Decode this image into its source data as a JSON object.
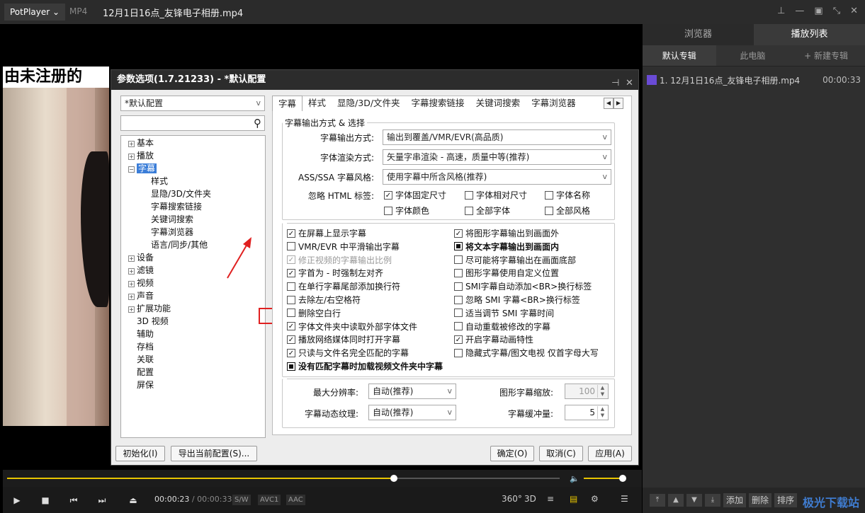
{
  "titlebar": {
    "app": "PotPlayer",
    "app_chevron": "⌄",
    "format": "MP4",
    "title": "12月1日16点_友锋电子相册.mp4",
    "buttons": [
      "pin-icon",
      "minimize-icon",
      "maximize-icon",
      "shrink-icon",
      "close-icon"
    ]
  },
  "video": {
    "overlay_text": "由未注册的"
  },
  "dialog": {
    "title": "参数选项(1.7.21233) - *默认配置",
    "profile_select": "*默认配置",
    "search_placeholder": "",
    "tree": [
      {
        "label": "基本",
        "expander": "+"
      },
      {
        "label": "播放",
        "expander": "+"
      },
      {
        "label": "字幕",
        "expander": "−",
        "selected": true
      },
      {
        "label": "样式"
      },
      {
        "label": "显隐/3D/文件夹"
      },
      {
        "label": "字幕搜索链接"
      },
      {
        "label": "关键词搜索"
      },
      {
        "label": "字幕浏览器"
      },
      {
        "label": "语言/同步/其他"
      },
      {
        "label": "设备",
        "expander": "+"
      },
      {
        "label": "滤镜",
        "expander": "+"
      },
      {
        "label": "视频",
        "expander": "+"
      },
      {
        "label": "声音",
        "expander": "+"
      },
      {
        "label": "扩展功能",
        "expander": "+"
      },
      {
        "label": "3D 视频"
      },
      {
        "label": "辅助"
      },
      {
        "label": "存档"
      },
      {
        "label": "关联"
      },
      {
        "label": "配置"
      },
      {
        "label": "屏保"
      }
    ],
    "tabs": [
      "字幕",
      "样式",
      "显隐/3D/文件夹",
      "字幕搜索链接",
      "关键词搜索",
      "字幕浏览器"
    ],
    "group_title": "字幕输出方式 & 选择",
    "output_mode_label": "字幕输出方式:",
    "output_mode_value": "输出到覆盖/VMR/EVR(高品质)",
    "font_render_label": "字体渲染方式:",
    "font_render_value": "矢量字串渲染 - 高速，质量中等(推荐)",
    "ass_label": "ASS/SSA 字幕风格:",
    "ass_value": "使用字幕中所含风格(推荐)",
    "html_label": "忽略 HTML 标签:",
    "html_opts": [
      {
        "label": "字体固定尺寸",
        "checked": true
      },
      {
        "label": "字体相对尺寸",
        "checked": false
      },
      {
        "label": "字体名称",
        "checked": false
      },
      {
        "label": "字体颜色",
        "checked": false
      },
      {
        "label": "全部字体",
        "checked": false
      },
      {
        "label": "全部风格",
        "checked": false
      }
    ],
    "left_checks": [
      {
        "label": "在屏幕上显示字幕",
        "state": "checked"
      },
      {
        "label": "VMR/EVR 中平滑输出字幕",
        "state": "unchecked"
      },
      {
        "label": "修正视频的字幕输出比例",
        "state": "disabled-checked"
      },
      {
        "label": "字首为 - 时强制左对齐",
        "state": "checked"
      },
      {
        "label": "在单行字幕尾部添加换行符",
        "state": "unchecked"
      },
      {
        "label": "去除左/右空格符",
        "state": "unchecked"
      },
      {
        "label": "删除空白行",
        "state": "unchecked"
      },
      {
        "label": "字体文件夹中读取外部字体文件",
        "state": "checked"
      },
      {
        "label": "播放网络媒体同时打开字幕",
        "state": "checked"
      },
      {
        "label": "只读与文件名完全匹配的字幕",
        "state": "checked"
      }
    ],
    "right_checks": [
      {
        "label": "将图形字幕输出到画面外",
        "state": "checked"
      },
      {
        "label": "将文本字幕输出到画面内",
        "state": "filled"
      },
      {
        "label": "尽可能将字幕输出在画面底部",
        "state": "unchecked"
      },
      {
        "label": "图形字幕使用自定义位置",
        "state": "unchecked"
      },
      {
        "label": "SMI字幕自动添加<BR>换行标签",
        "state": "unchecked"
      },
      {
        "label": "忽略 SMI 字幕<BR>换行标签",
        "state": "unchecked"
      },
      {
        "label": "适当调节 SMI 字幕时间",
        "state": "unchecked"
      },
      {
        "label": "自动重载被修改的字幕",
        "state": "unchecked"
      },
      {
        "label": "开启字幕动画特性",
        "state": "checked"
      },
      {
        "label": "隐藏式字幕/图文电视 仅首字母大写",
        "state": "unchecked"
      }
    ],
    "wide_check": {
      "label": "没有匹配字幕时加载视频文件夹中字幕",
      "state": "filled"
    },
    "max_res_label": "最大分辨率:",
    "max_res_value": "自动(推荐)",
    "anim_tex_label": "字幕动态纹理:",
    "anim_tex_value": "自动(推荐)",
    "gfx_scale_label": "图形字幕缩放:",
    "gfx_scale_value": "100",
    "buffer_label": "字幕缓冲量:",
    "buffer_value": "5",
    "buttons": {
      "init": "初始化(I)",
      "export": "导出当前配置(S)...",
      "ok": "确定(O)",
      "cancel": "取消(C)",
      "apply": "应用(A)"
    }
  },
  "side": {
    "tabs": [
      "浏览器",
      "播放列表"
    ],
    "active_tab": "播放列表",
    "subtabs": [
      "默认专辑",
      "此电脑",
      "+ 新建专辑"
    ],
    "playlist": [
      {
        "label": "1. 12月1日16点_友锋电子相册.mp4",
        "duration": "00:00:33"
      }
    ],
    "bottom_buttons": [
      "添加",
      "删除",
      "排序"
    ]
  },
  "player": {
    "current_time": "00:00:23",
    "total_time": "/ 00:00:33",
    "progress_fraction": 0.7,
    "volume_fraction": 0.9,
    "badges": [
      "S/W",
      "AVC1",
      "AAC"
    ],
    "right_icons": [
      "360°",
      "3D"
    ]
  },
  "watermark": "极光下载站"
}
